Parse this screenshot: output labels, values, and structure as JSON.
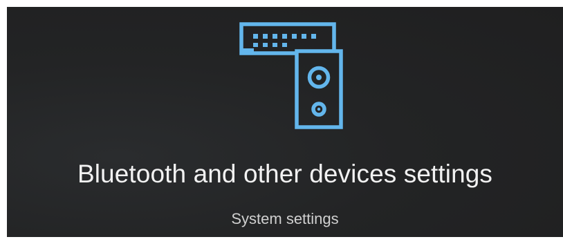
{
  "result": {
    "icon": "keyboard-speaker-devices-icon",
    "title": "Bluetooth and other devices settings",
    "subtitle": "System settings"
  },
  "colors": {
    "accent": "#63b6ec",
    "background": "#222324",
    "title_text": "#f2f2f2",
    "subtitle_text": "#d0d0d0"
  }
}
